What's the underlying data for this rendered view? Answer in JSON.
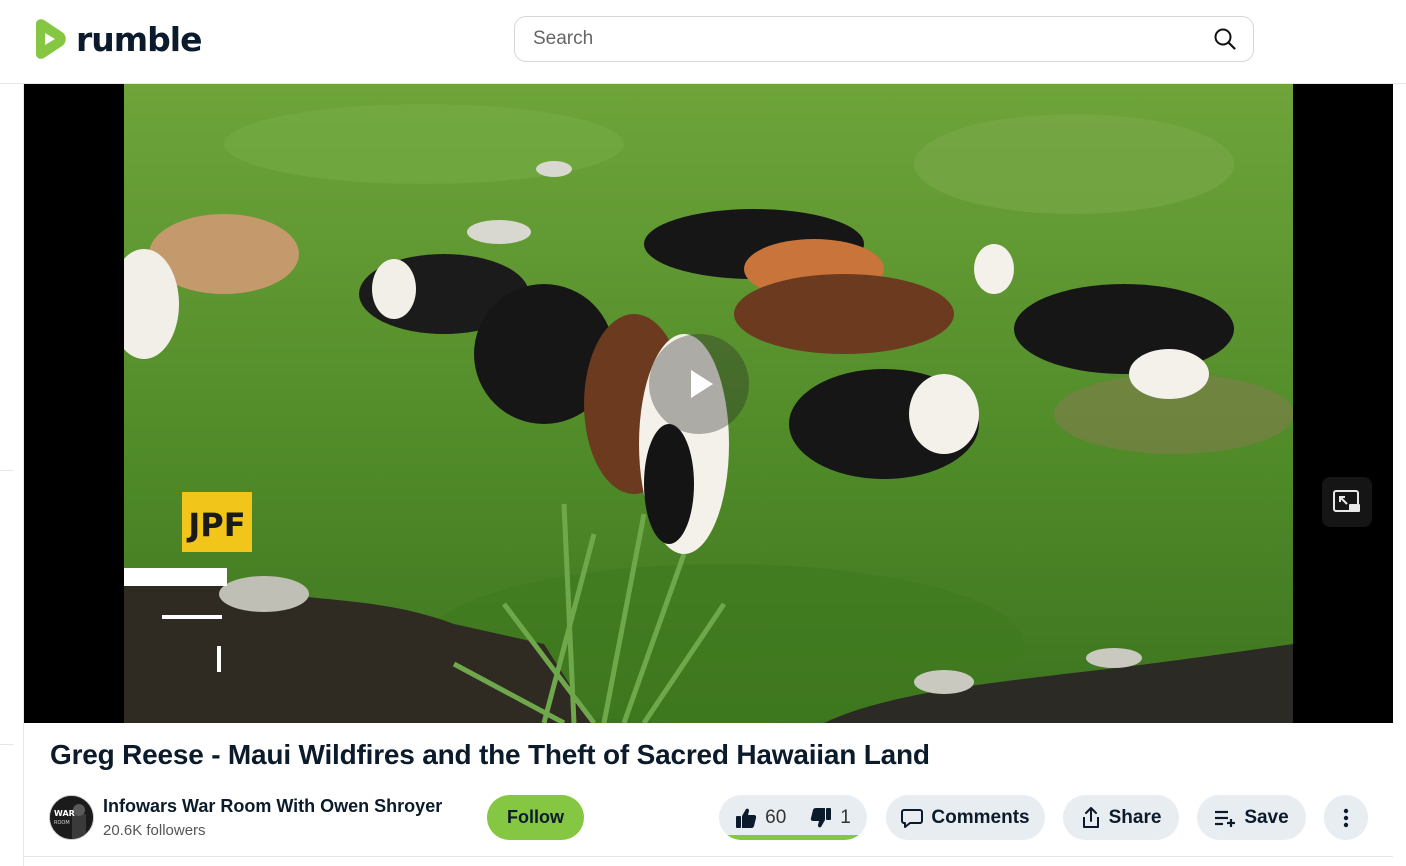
{
  "brand": {
    "name": "rumble",
    "accent": "#85c742"
  },
  "search": {
    "placeholder": "Search",
    "icon": "search-icon"
  },
  "player": {
    "overlay_badge": "JPF",
    "play_icon": "play-icon",
    "pip_icon": "picture-in-picture-icon"
  },
  "video": {
    "title": "Greg Reese - Maui Wildfires and the Theft of Sacred Hawaiian Land"
  },
  "channel": {
    "name": "Infowars War Room With Owen Shroyer",
    "followers": "20.6K followers",
    "avatar_text": "WAR ROOM",
    "follow_label": "Follow"
  },
  "actions": {
    "likes": "60",
    "dislikes": "1",
    "like_ratio": 0.98,
    "comments_label": "Comments",
    "share_label": "Share",
    "save_label": "Save"
  }
}
